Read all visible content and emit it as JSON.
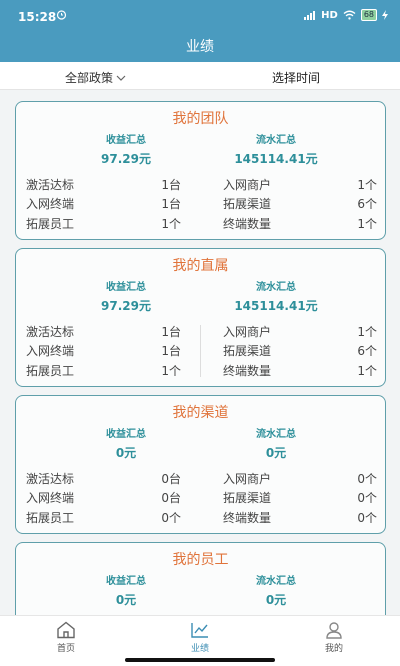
{
  "status": {
    "time": "15:28",
    "network": "HD",
    "battery": "68"
  },
  "header": {
    "title": "业绩"
  },
  "filter": {
    "policy": "全部政策",
    "time": "选择时间"
  },
  "cards": [
    {
      "title": "我的团队",
      "income_label": "收益汇总",
      "income": "97.29元",
      "flow_label": "流水汇总",
      "flow": "145114.41元",
      "rows": [
        {
          "l": "激活达标",
          "lv": "1台",
          "r": "入网商户",
          "rv": "1个"
        },
        {
          "l": "入网终端",
          "lv": "1台",
          "r": "拓展渠道",
          "rv": "6个"
        },
        {
          "l": "拓展员工",
          "lv": "1个",
          "r": "终端数量",
          "rv": "1个"
        }
      ]
    },
    {
      "title": "我的直属",
      "income_label": "收益汇总",
      "income": "97.29元",
      "flow_label": "流水汇总",
      "flow": "145114.41元",
      "rows": [
        {
          "l": "激活达标",
          "lv": "1台",
          "r": "入网商户",
          "rv": "1个"
        },
        {
          "l": "入网终端",
          "lv": "1台",
          "r": "拓展渠道",
          "rv": "6个"
        },
        {
          "l": "拓展员工",
          "lv": "1个",
          "r": "终端数量",
          "rv": "1个"
        }
      ]
    },
    {
      "title": "我的渠道",
      "income_label": "收益汇总",
      "income": "0元",
      "flow_label": "流水汇总",
      "flow": "0元",
      "rows": [
        {
          "l": "激活达标",
          "lv": "0台",
          "r": "入网商户",
          "rv": "0个"
        },
        {
          "l": "入网终端",
          "lv": "0台",
          "r": "拓展渠道",
          "rv": "0个"
        },
        {
          "l": "拓展员工",
          "lv": "0个",
          "r": "终端数量",
          "rv": "0个"
        }
      ]
    },
    {
      "title": "我的员工",
      "income_label": "收益汇总",
      "income": "0元",
      "flow_label": "流水汇总",
      "flow": "0元",
      "rows": []
    }
  ],
  "nav": {
    "home": "首页",
    "performance": "业绩",
    "mine": "我的"
  },
  "colors": {
    "header": "#4a9bbf",
    "card_title": "#e0733a",
    "value": "#2d8f9a",
    "nav_active": "#3c8db3"
  }
}
